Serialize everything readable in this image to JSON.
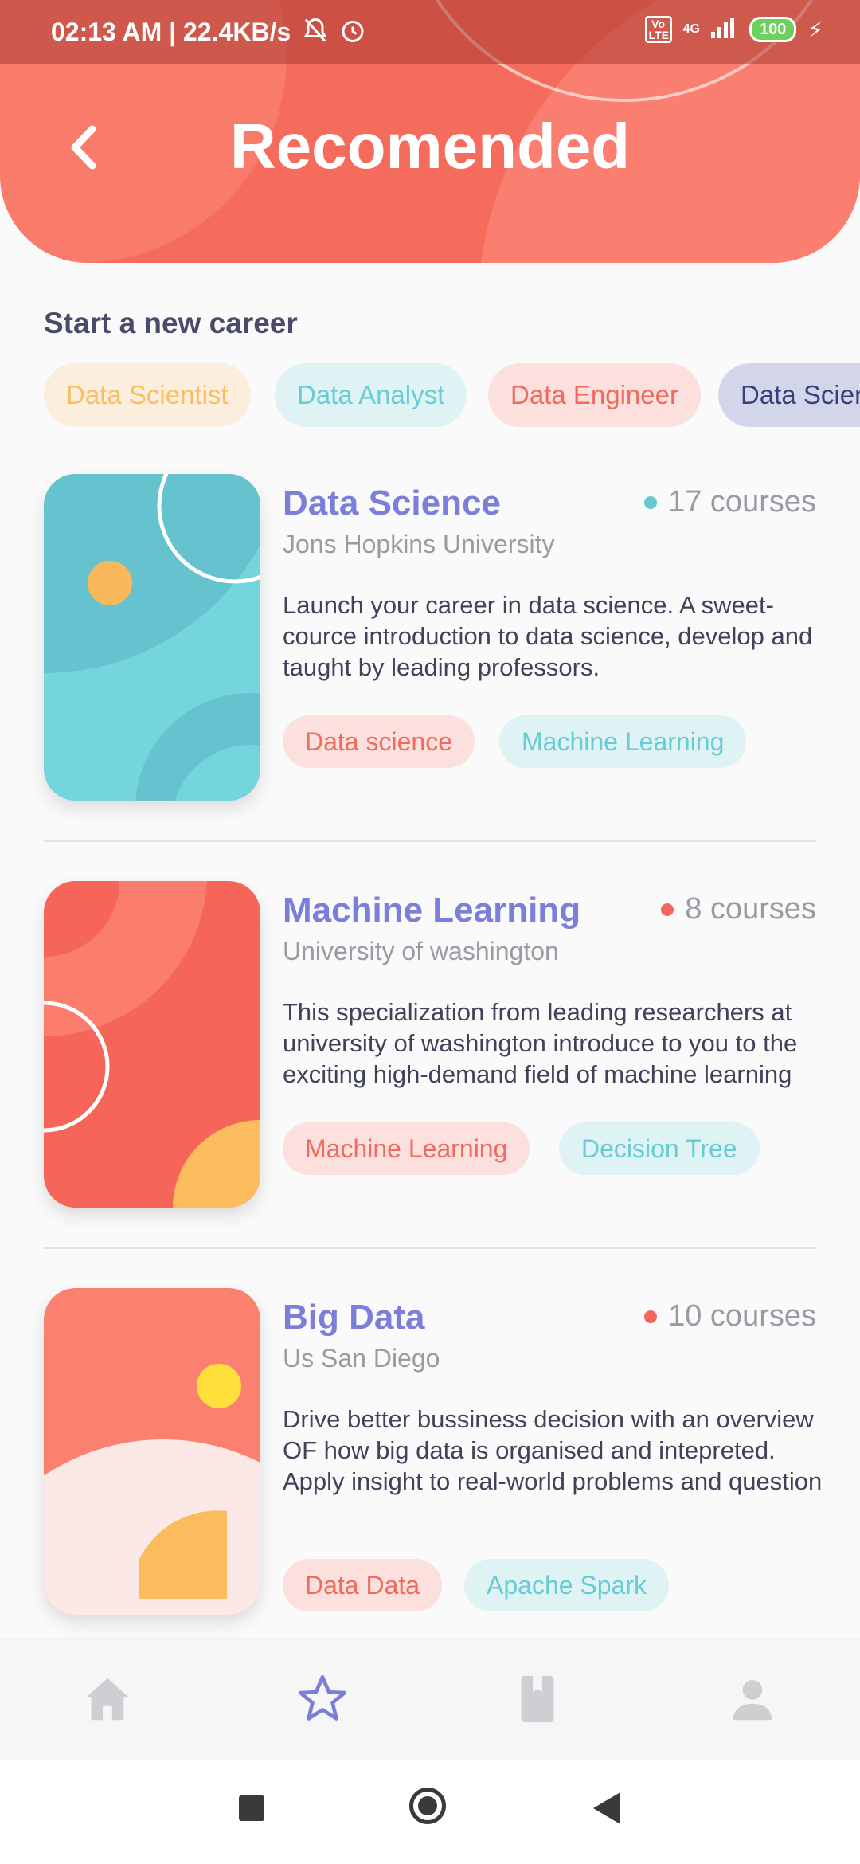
{
  "status": {
    "time": "02:13 AM | 22.4KB/s",
    "network": "4G",
    "volte": "Vo LTE",
    "battery": "100"
  },
  "header": {
    "title": "Recomended",
    "back_icon": "chevron-left-icon"
  },
  "careers": {
    "section_title": "Start a new career",
    "chips": [
      "Data Scientist",
      "Data Analyst",
      "Data Engineer",
      "Data Scien"
    ]
  },
  "courses": [
    {
      "title": "Data Science",
      "courses_count": "17 courses",
      "university": "Jons Hopkins University",
      "description": "Launch your career in data science. A sweet-cource introduction to data science, develop and taught by leading professors.",
      "tags": [
        "Data science",
        "Machine Learning"
      ],
      "dot_color": "#64c7d1"
    },
    {
      "title": "Machine Learning",
      "courses_count": "8 courses",
      "university": "University of washington",
      "description": "This specialization from leading researchers at university of washington introduce to you to the exciting high-demand field of machine learning",
      "tags": [
        "Machine Learning",
        "Decision Tree"
      ],
      "dot_color": "#f4655a"
    },
    {
      "title": "Big Data",
      "courses_count": "10 courses",
      "university": "Us San Diego",
      "description": "Drive better bussiness decision with an overview OF how big data is organised  and intepreted. Apply insight to real-world problems and question",
      "tags": [
        "Data Data",
        "Apache Spark"
      ],
      "dot_color": "#f4655a"
    }
  ],
  "bottom_nav": {
    "items": [
      "home-icon",
      "star-icon",
      "book-icon",
      "person-icon"
    ],
    "active": "star-icon"
  },
  "colors": {
    "accent": "#f66c5c",
    "primary_text": "#7b7fd9"
  }
}
